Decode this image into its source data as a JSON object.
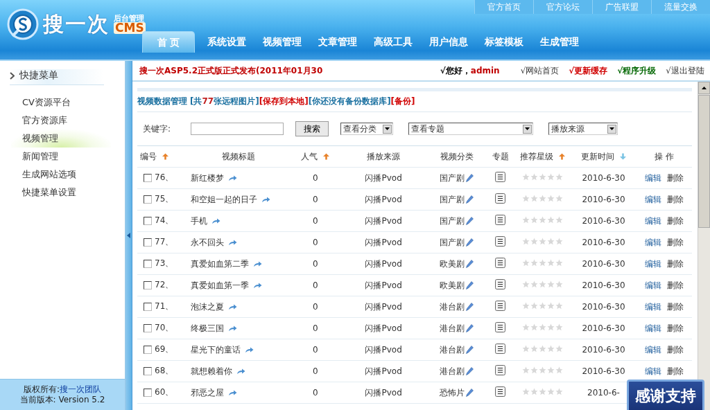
{
  "logo": {
    "name": "搜一次",
    "tag": "后台管理",
    "product": "CMS"
  },
  "top_links": [
    "官方首页",
    "官方论坛",
    "广告联盟",
    "流量交换"
  ],
  "nav_tabs": [
    {
      "label": "首 页",
      "selected": true
    },
    {
      "label": "系统设置",
      "selected": false
    },
    {
      "label": "视频管理",
      "selected": false
    },
    {
      "label": "文章管理",
      "selected": false
    },
    {
      "label": "高级工具",
      "selected": false
    },
    {
      "label": "用户信息",
      "selected": false
    },
    {
      "label": "标签模板",
      "selected": false
    },
    {
      "label": "生成管理",
      "selected": false
    }
  ],
  "sidebar": {
    "title": "快捷菜单",
    "items": [
      {
        "label": "CV资源平台",
        "selected": false
      },
      {
        "label": "官方资源库",
        "selected": false
      },
      {
        "label": "视频管理",
        "selected": true
      },
      {
        "label": "新闻管理",
        "selected": false
      },
      {
        "label": "生成网站选项",
        "selected": false
      },
      {
        "label": "快捷菜单设置",
        "selected": false
      }
    ],
    "copyright_label": "版权所有:",
    "copyright_link": "搜一次团队",
    "version": "当前版本: Version 5.2"
  },
  "notice": "搜一次ASP5.2正式版正式发布(2011年01月30",
  "greeting": "√您好，",
  "user": "admin",
  "user_links": [
    {
      "label": "√网站首页",
      "kind": "plain"
    },
    {
      "label": "√更新缓存",
      "kind": "alert"
    },
    {
      "label": "√程序升级",
      "kind": "ok"
    },
    {
      "label": "√退出登陆",
      "kind": "plain"
    }
  ],
  "panel_title": "视频数据管理",
  "panel_links": [
    {
      "label": "[共**77**张远程图片]",
      "kind": "info"
    },
    {
      "label": "[保存到本地]",
      "kind": "alert"
    },
    {
      "label": "[你还没有备份数据库]",
      "kind": "info"
    },
    {
      "label": "[备份]",
      "kind": "alert"
    }
  ],
  "filters": {
    "keyword_label": "关键字:",
    "search_button": "搜索",
    "selects": [
      "查看分类",
      "查看专题",
      "播放来源"
    ]
  },
  "table": {
    "columns": [
      {
        "label": "编号",
        "sort_icon": true,
        "descending": false
      },
      {
        "label": "视频标题",
        "sort_icon": false
      },
      {
        "label": "人气",
        "sort_icon": true,
        "descending": false
      },
      {
        "label": "播放来源",
        "sort_icon": false
      },
      {
        "label": "视频分类",
        "sort_icon": false
      },
      {
        "label": "专题",
        "sort_icon": false
      },
      {
        "label": "推荐星级",
        "sort_icon": true,
        "descending": false
      },
      {
        "label": "更新时间",
        "sort_icon": true,
        "descending": true
      },
      {
        "label": "操 作",
        "sort_icon": false
      }
    ],
    "rows": [
      {
        "checked": false,
        "id": "76、",
        "title": "新红楼梦",
        "hits": "0",
        "source": "闪播Pvod",
        "category": "国产剧",
        "stars": 0,
        "date": "2010-6-30",
        "actions": [
          "编辑",
          "删除"
        ]
      },
      {
        "checked": false,
        "id": "75、",
        "title": "和空姐一起的日子",
        "hits": "0",
        "source": "闪播Pvod",
        "category": "国产剧",
        "stars": 0,
        "date": "2010-6-30",
        "actions": [
          "编辑",
          "删除"
        ]
      },
      {
        "checked": false,
        "id": "74、",
        "title": "手机",
        "hits": "0",
        "source": "闪播Pvod",
        "category": "国产剧",
        "stars": 0,
        "date": "2010-6-30",
        "actions": [
          "编辑",
          "删除"
        ]
      },
      {
        "checked": false,
        "id": "77、",
        "title": "永不回头",
        "hits": "0",
        "source": "闪播Pvod",
        "category": "国产剧",
        "stars": 0,
        "date": "2010-6-30",
        "actions": [
          "编辑",
          "删除"
        ]
      },
      {
        "checked": false,
        "id": "73、",
        "title": "真爱如血第二季",
        "hits": "0",
        "source": "闪播Pvod",
        "category": "欧美剧",
        "stars": 0,
        "date": "2010-6-30",
        "actions": [
          "编辑",
          "删除"
        ]
      },
      {
        "checked": false,
        "id": "72、",
        "title": "真爱如血第一季",
        "hits": "0",
        "source": "闪播Pvod",
        "category": "欧美剧",
        "stars": 0,
        "date": "2010-6-30",
        "actions": [
          "编辑",
          "删除"
        ]
      },
      {
        "checked": false,
        "id": "71、",
        "title": "泡沫之夏",
        "hits": "0",
        "source": "闪播Pvod",
        "category": "港台剧",
        "stars": 0,
        "date": "2010-6-30",
        "actions": [
          "编辑",
          "删除"
        ]
      },
      {
        "checked": false,
        "id": "70、",
        "title": "终极三国",
        "hits": "0",
        "source": "闪播Pvod",
        "category": "港台剧",
        "stars": 0,
        "date": "2010-6-30",
        "actions": [
          "编辑",
          "删除"
        ]
      },
      {
        "checked": false,
        "id": "69、",
        "title": "星光下的童话",
        "hits": "0",
        "source": "闪播Pvod",
        "category": "港台剧",
        "stars": 0,
        "date": "2010-6-30",
        "actions": [
          "编辑",
          "删除"
        ]
      },
      {
        "checked": false,
        "id": "68、",
        "title": "就想赖着你",
        "hits": "0",
        "source": "闪播Pvod",
        "category": "港台剧",
        "stars": 0,
        "date": "2010-6-30",
        "actions": [
          "编辑",
          "删除"
        ]
      },
      {
        "checked": false,
        "id": "60、",
        "title": "邪恶之屋",
        "hits": "0",
        "source": "闪播Pvod",
        "category": "恐怖片",
        "stars": 0,
        "date": "2010-6-"
      }
    ]
  },
  "support_badge": "感谢支持"
}
